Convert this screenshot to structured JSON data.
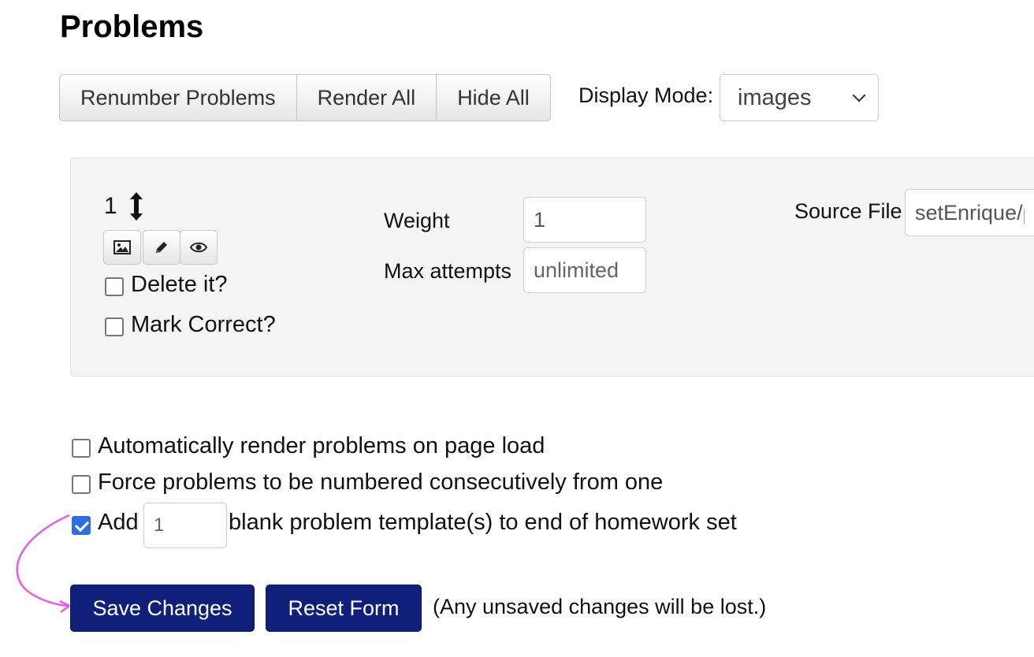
{
  "page": {
    "title": "Problems"
  },
  "toolbar": {
    "renumber_label": "Renumber Problems",
    "render_all_label": "Render All",
    "hide_all_label": "Hide All",
    "display_mode_label": "Display Mode:",
    "display_mode_value": "images"
  },
  "problem": {
    "number": "1",
    "move_icon": "vertical-resize-arrows-icon",
    "action_icons": [
      "image-icon",
      "pencil-icon",
      "eye-icon"
    ],
    "delete_label": "Delete it?",
    "delete_checked": false,
    "mark_correct_label": "Mark Correct?",
    "mark_correct_checked": false,
    "weight_label": "Weight",
    "weight_value": "1",
    "max_attempts_label": "Max attempts",
    "max_attempts_placeholder": "unlimited",
    "source_file_label": "Source File",
    "source_file_value": "setEnrique/p"
  },
  "options": {
    "auto_render_label": "Automatically render problems on page load",
    "auto_render_checked": false,
    "force_number_label": "Force problems to be numbered consecutively from one",
    "force_number_checked": false,
    "add_label_prefix": "Add",
    "add_count_value": "1",
    "add_label_suffix": "blank problem template(s) to end of homework set",
    "add_checked": true
  },
  "footer": {
    "save_label": "Save Changes",
    "reset_label": "Reset Form",
    "note": "(Any unsaved changes will be lost.)"
  },
  "colors": {
    "primary_button": "#0f1f7a",
    "checkbox_checked": "#2f6fe4",
    "annotation_arrow": "#e85ce8"
  }
}
